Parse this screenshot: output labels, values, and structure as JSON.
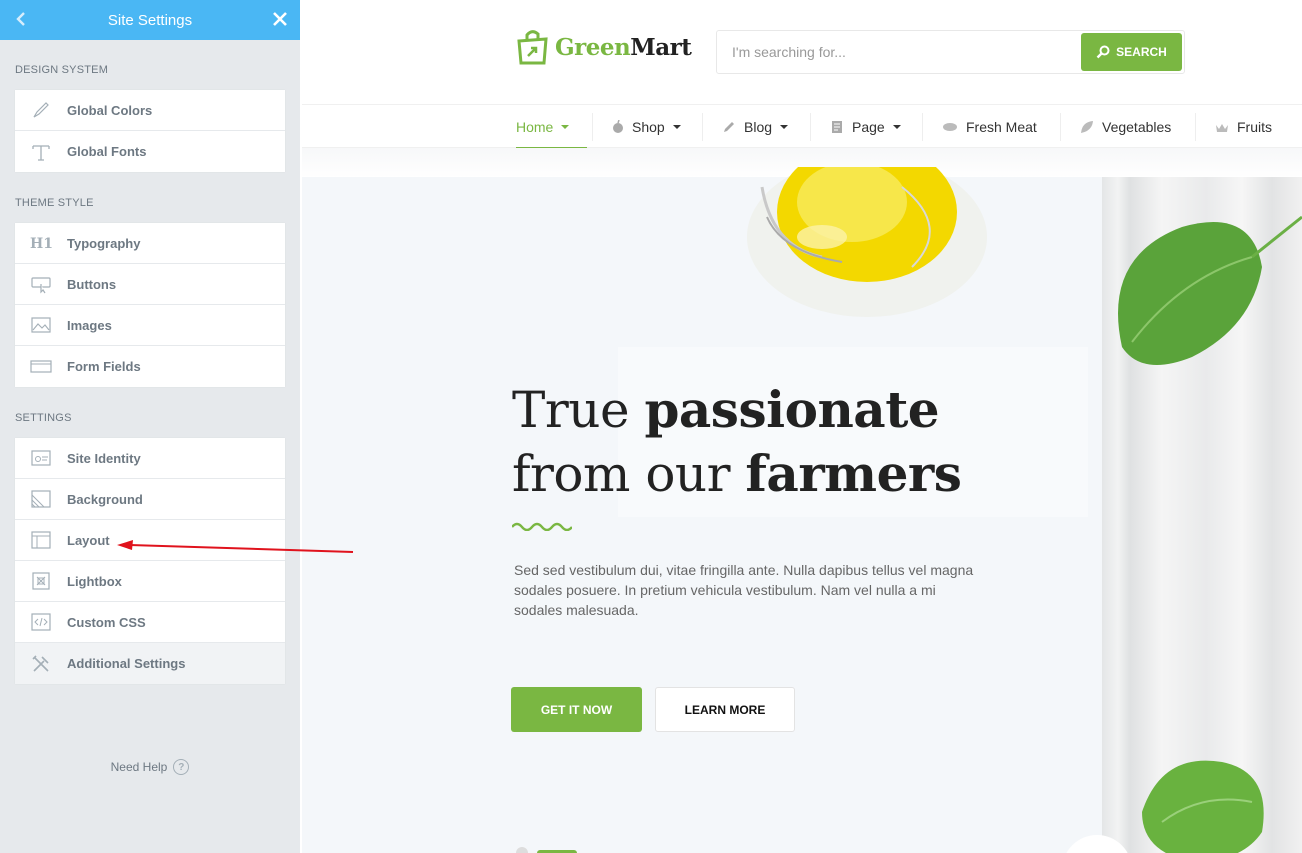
{
  "sidebar": {
    "title": "Site Settings",
    "sections": [
      {
        "heading": "Design System",
        "items": [
          {
            "label": "Global Colors",
            "icon": "paintbrush-icon"
          },
          {
            "label": "Global Fonts",
            "icon": "typography-t-icon"
          }
        ]
      },
      {
        "heading": "Theme Style",
        "items": [
          {
            "label": "Typography",
            "icon": "heading-h1-icon"
          },
          {
            "label": "Buttons",
            "icon": "button-cursor-icon"
          },
          {
            "label": "Images",
            "icon": "image-icon"
          },
          {
            "label": "Form Fields",
            "icon": "form-field-icon"
          }
        ]
      },
      {
        "heading": "Settings",
        "items": [
          {
            "label": "Site Identity",
            "icon": "site-identity-icon"
          },
          {
            "label": "Background",
            "icon": "background-icon"
          },
          {
            "label": "Layout",
            "icon": "layout-icon"
          },
          {
            "label": "Lightbox",
            "icon": "lightbox-icon"
          },
          {
            "label": "Custom CSS",
            "icon": "code-icon"
          },
          {
            "label": "Additional Settings",
            "icon": "tools-icon"
          }
        ]
      }
    ],
    "need_help": "Need Help",
    "help_glyph": "?"
  },
  "site": {
    "logo": {
      "part1": "Green",
      "part2": "Mart"
    },
    "search": {
      "placeholder": "I'm searching for...",
      "button": "SEARCH"
    },
    "nav": [
      {
        "label": "Home",
        "icon": "",
        "dropdown": true,
        "active": true
      },
      {
        "label": "Shop",
        "icon": "apple-icon",
        "dropdown": true
      },
      {
        "label": "Blog",
        "icon": "pencil-icon",
        "dropdown": true
      },
      {
        "label": "Page",
        "icon": "page-icon",
        "dropdown": true
      },
      {
        "label": "Fresh Meat",
        "icon": "meat-icon",
        "dropdown": false
      },
      {
        "label": "Vegetables",
        "icon": "leaf-icon",
        "dropdown": false
      },
      {
        "label": "Fruits",
        "icon": "fruit-icon",
        "dropdown": false
      }
    ],
    "hero": {
      "title_light_1": "True ",
      "title_bold_1": "passionate",
      "title_light_2": " from our ",
      "title_bold_2": "farmers",
      "body": "Sed sed vestibulum dui, vitae fringilla ante. Nulla dapibus tellus vel magna sodales posuere. In pretium vehicula vestibulum. Nam vel nulla a mi sodales malesuada.",
      "cta_primary": "GET IT NOW",
      "cta_secondary": "LEARN MORE"
    }
  },
  "colors": {
    "accent": "#7ab742",
    "header_blue": "#4ab7f4",
    "annotation": "#e0131d"
  }
}
